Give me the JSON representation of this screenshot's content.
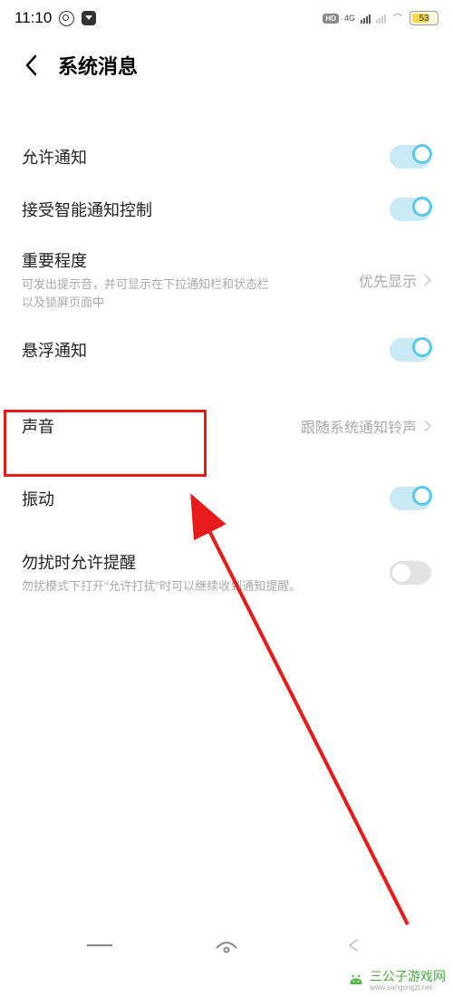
{
  "status_bar": {
    "time": "11:10",
    "hd_badge": "HD",
    "network": "4G",
    "battery": "53"
  },
  "header": {
    "title": "系统消息"
  },
  "items": {
    "allow_notification": {
      "label": "允许通知",
      "on": true
    },
    "smart_control": {
      "label": "接受智能通知控制",
      "on": true
    },
    "importance": {
      "label": "重要程度",
      "desc": "可发出提示音，并可显示在下拉通知栏和状态栏以及锁屏页面中",
      "value": "优先显示"
    },
    "floating": {
      "label": "悬浮通知",
      "on": true
    },
    "sound": {
      "label": "声音",
      "value": "跟随系统通知铃声"
    },
    "vibration": {
      "label": "振动",
      "on": true
    },
    "dnd": {
      "label": "勿扰时允许提醒",
      "desc": "勿扰模式下打开\"允许打扰\"时可以继续收到通知提醒。",
      "on": false
    }
  },
  "watermark": {
    "text": "三公子游戏网",
    "url": "www.sangongzi.net"
  },
  "annotation": {
    "highlight_color": "#e81b1b",
    "highlight_target": "sound"
  }
}
